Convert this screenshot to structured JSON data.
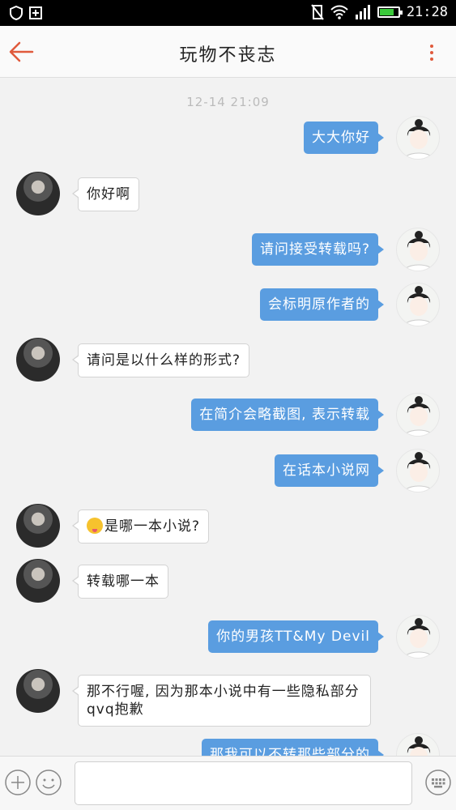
{
  "status_bar": {
    "time": "21:28",
    "battery_level": 0.7,
    "icons": [
      "shield-icon",
      "plus-box-icon",
      "vibrate-off-icon",
      "wifi-icon",
      "signal-icon",
      "battery-icon"
    ]
  },
  "header": {
    "title": "玩物不丧志",
    "back_icon": "arrow-left-icon",
    "more_icon": "more-vertical-icon"
  },
  "accent_color": "#5a9de0",
  "timestamp": "12-14 21:09",
  "messages": [
    {
      "side": "right",
      "text": "大大你好"
    },
    {
      "side": "left",
      "text": "你好啊"
    },
    {
      "side": "right",
      "text": "请问接受转载吗?"
    },
    {
      "side": "right",
      "text": "会标明原作者的"
    },
    {
      "side": "left",
      "text": "请问是以什么样的形式?"
    },
    {
      "side": "right",
      "text": "在简介会略截图, 表示转载"
    },
    {
      "side": "right",
      "text": "在话本小说网"
    },
    {
      "side": "left",
      "text": "是哪一本小说?",
      "emoji": "tongue-emoji"
    },
    {
      "side": "left",
      "text": "转载哪一本"
    },
    {
      "side": "right",
      "text": "你的男孩TT&My Devil"
    },
    {
      "side": "left",
      "text": "那不行喔, 因为那本小说中有一些隐私部分qvq抱歉"
    },
    {
      "side": "right",
      "text": "那我可以不转那些部分的"
    }
  ],
  "input_bar": {
    "placeholder": "",
    "value": "",
    "icons": [
      "plus-circle-icon",
      "smiley-icon",
      "keyboard-icon"
    ]
  }
}
